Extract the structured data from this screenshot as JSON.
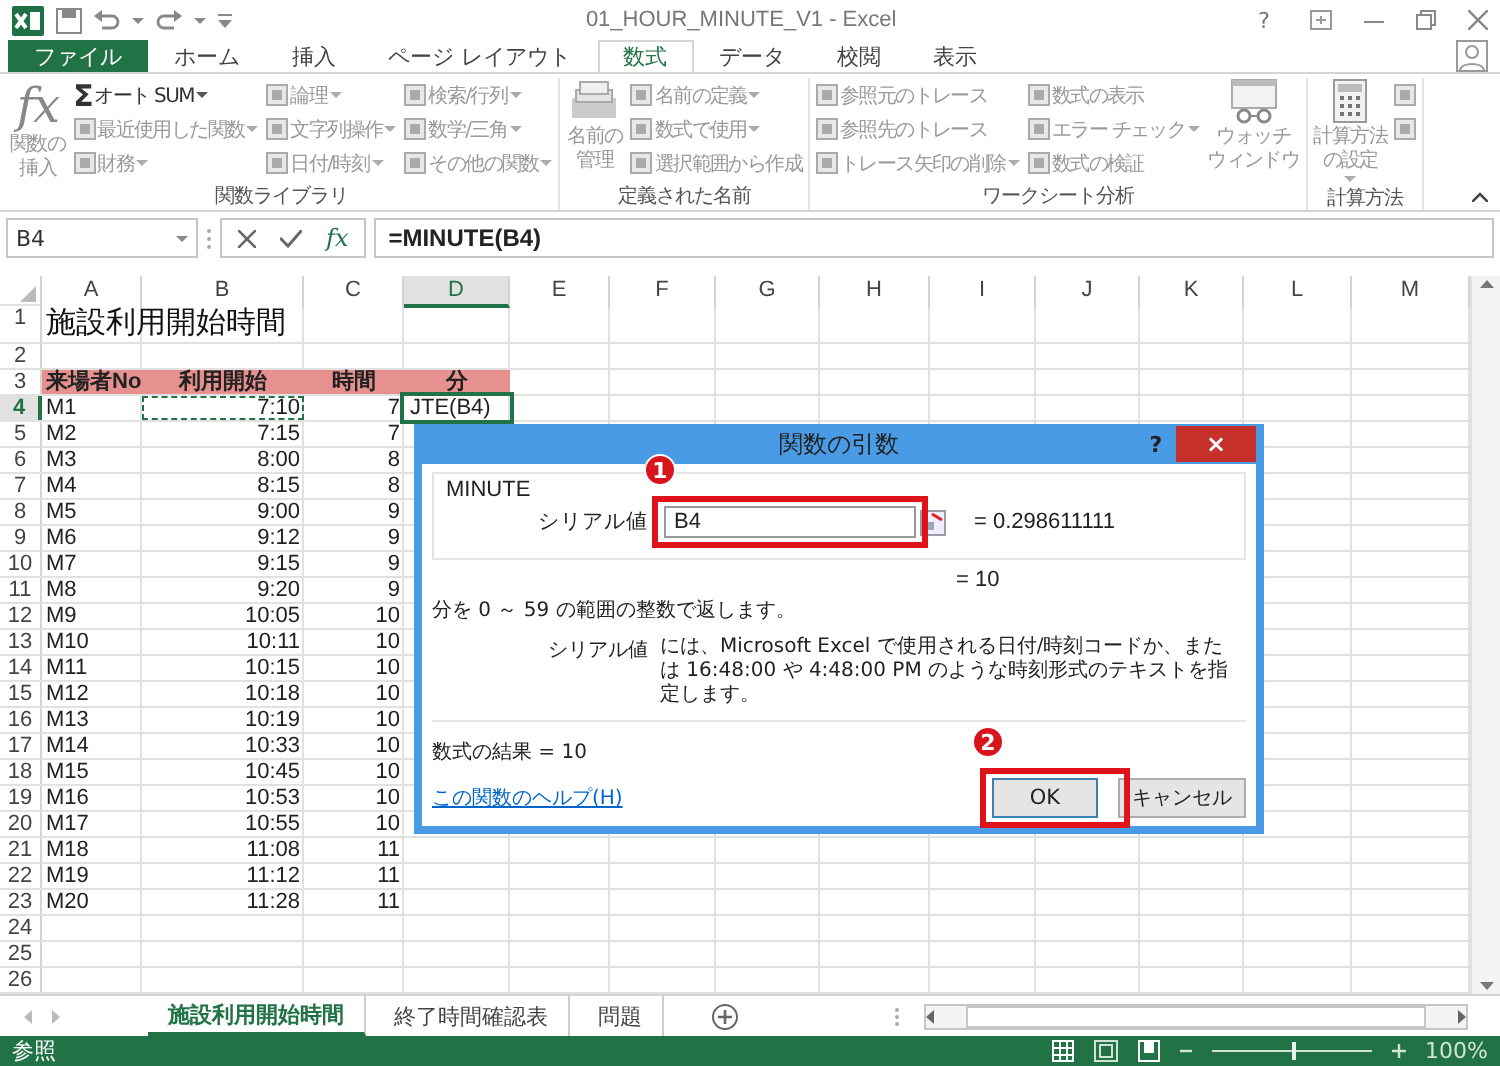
{
  "window": {
    "title": "01_HOUR_MINUTE_V1 - Excel",
    "help": "?"
  },
  "ribbon_tabs": [
    {
      "label": "ファイル",
      "kind": "file",
      "selected": false
    },
    {
      "label": "ホーム",
      "kind": "tab",
      "selected": false
    },
    {
      "label": "挿入",
      "kind": "tab",
      "selected": false
    },
    {
      "label": "ページ レイアウト",
      "kind": "tab",
      "selected": false
    },
    {
      "label": "数式",
      "kind": "tab",
      "selected": true
    },
    {
      "label": "データ",
      "kind": "tab",
      "selected": false
    },
    {
      "label": "校閲",
      "kind": "tab",
      "selected": false
    },
    {
      "label": "表示",
      "kind": "tab",
      "selected": false
    }
  ],
  "ribbon": {
    "groups": [
      {
        "label": "関数ライブラリ",
        "columns": [
          [
            {
              "kind": "large",
              "icon_text": "fx",
              "label_lines": [
                "関数の",
                "挿入"
              ],
              "disabled": true,
              "dropdown": false
            }
          ],
          [
            {
              "kind": "small",
              "icon_text": "Σ",
              "label": "オート SUM",
              "disabled": false,
              "dropdown": true
            },
            {
              "kind": "small",
              "label": "最近使用した関数",
              "disabled": true,
              "dropdown": true
            },
            {
              "kind": "small",
              "label": "財務",
              "disabled": true,
              "dropdown": true
            }
          ],
          [
            {
              "kind": "small",
              "label": "論理",
              "disabled": true,
              "dropdown": true
            },
            {
              "kind": "small",
              "label": "文字列操作",
              "disabled": true,
              "dropdown": true
            },
            {
              "kind": "small",
              "label": "日付/時刻",
              "disabled": true,
              "dropdown": true
            }
          ],
          [
            {
              "kind": "small",
              "label": "検索/行列",
              "disabled": true,
              "dropdown": true
            },
            {
              "kind": "small",
              "label": "数学/三角",
              "disabled": true,
              "dropdown": true
            },
            {
              "kind": "small",
              "label": "その他の関数",
              "disabled": true,
              "dropdown": true
            }
          ]
        ]
      },
      {
        "label": "定義された名前",
        "columns": [
          [
            {
              "kind": "large",
              "label_lines": [
                "名前の",
                "管理"
              ],
              "disabled": true,
              "dropdown": false
            }
          ],
          [
            {
              "kind": "small",
              "label": "名前の定義",
              "disabled": true,
              "dropdown": true
            },
            {
              "kind": "small",
              "label": "数式で使用",
              "disabled": true,
              "dropdown": true
            },
            {
              "kind": "small",
              "label": "選択範囲から作成",
              "disabled": true,
              "dropdown": false
            }
          ]
        ]
      },
      {
        "label": "ワークシート分析",
        "columns": [
          [
            {
              "kind": "small",
              "label": "参照元のトレース",
              "disabled": true,
              "dropdown": false
            },
            {
              "kind": "small",
              "label": "参照先のトレース",
              "disabled": true,
              "dropdown": false
            },
            {
              "kind": "small",
              "label": "トレース矢印の削除",
              "disabled": true,
              "dropdown": true
            }
          ],
          [
            {
              "kind": "small",
              "label": "数式の表示",
              "disabled": true,
              "dropdown": false
            },
            {
              "kind": "small",
              "label": "エラー チェック",
              "disabled": true,
              "dropdown": true
            },
            {
              "kind": "small",
              "label": "数式の検証",
              "disabled": true,
              "dropdown": false
            }
          ],
          [
            {
              "kind": "large",
              "label_lines": [
                "ウォッチ",
                "ウィンドウ"
              ],
              "disabled": true,
              "dropdown": false
            }
          ]
        ]
      },
      {
        "label": "計算方法",
        "columns": [
          [
            {
              "kind": "large",
              "label_lines": [
                "計算方法",
                "の設定"
              ],
              "disabled": true,
              "dropdown": true
            }
          ],
          [
            {
              "kind": "icon",
              "disabled": true,
              "dropdown": false
            },
            {
              "kind": "icon",
              "disabled": true,
              "dropdown": false
            }
          ]
        ]
      }
    ]
  },
  "formula_bar": {
    "name_box": "B4",
    "fx": "fx",
    "formula": "=MINUTE(B4)"
  },
  "grid": {
    "columns": [
      {
        "label": "A",
        "selected": false
      },
      {
        "label": "B",
        "selected": false
      },
      {
        "label": "C",
        "selected": false
      },
      {
        "label": "D",
        "selected": true
      },
      {
        "label": "E",
        "selected": false
      },
      {
        "label": "F",
        "selected": false
      },
      {
        "label": "G",
        "selected": false
      },
      {
        "label": "H",
        "selected": false
      },
      {
        "label": "I",
        "selected": false
      },
      {
        "label": "J",
        "selected": false
      },
      {
        "label": "K",
        "selected": false
      },
      {
        "label": "L",
        "selected": false
      },
      {
        "label": "M",
        "selected": false
      }
    ],
    "rows": [
      {
        "label": "1",
        "kind": "title",
        "selected": false,
        "cells": [
          "施設利用開始時間"
        ]
      },
      {
        "label": "2",
        "kind": "data",
        "selected": false,
        "cells": []
      },
      {
        "label": "3",
        "kind": "header",
        "selected": false,
        "cells": [
          "来場者No",
          "利用開始",
          "時間",
          "分"
        ]
      },
      {
        "label": "4",
        "kind": "editing",
        "selected": true,
        "cells": [
          "M1",
          "7:10",
          "7",
          "JTE(B4)"
        ]
      },
      {
        "label": "5",
        "kind": "data",
        "selected": false,
        "cells": [
          "M2",
          "7:15",
          "7"
        ]
      },
      {
        "label": "6",
        "kind": "data",
        "selected": false,
        "cells": [
          "M3",
          "8:00",
          "8"
        ]
      },
      {
        "label": "7",
        "kind": "data",
        "selected": false,
        "cells": [
          "M4",
          "8:15",
          "8"
        ]
      },
      {
        "label": "8",
        "kind": "data",
        "selected": false,
        "cells": [
          "M5",
          "9:00",
          "9"
        ]
      },
      {
        "label": "9",
        "kind": "data",
        "selected": false,
        "cells": [
          "M6",
          "9:12",
          "9"
        ]
      },
      {
        "label": "10",
        "kind": "data",
        "selected": false,
        "cells": [
          "M7",
          "9:15",
          "9"
        ]
      },
      {
        "label": "11",
        "kind": "data",
        "selected": false,
        "cells": [
          "M8",
          "9:20",
          "9"
        ]
      },
      {
        "label": "12",
        "kind": "data",
        "selected": false,
        "cells": [
          "M9",
          "10:05",
          "10"
        ]
      },
      {
        "label": "13",
        "kind": "data",
        "selected": false,
        "cells": [
          "M10",
          "10:11",
          "10"
        ]
      },
      {
        "label": "14",
        "kind": "data",
        "selected": false,
        "cells": [
          "M11",
          "10:15",
          "10"
        ]
      },
      {
        "label": "15",
        "kind": "data",
        "selected": false,
        "cells": [
          "M12",
          "10:18",
          "10"
        ]
      },
      {
        "label": "16",
        "kind": "data",
        "selected": false,
        "cells": [
          "M13",
          "10:19",
          "10"
        ]
      },
      {
        "label": "17",
        "kind": "data",
        "selected": false,
        "cells": [
          "M14",
          "10:33",
          "10"
        ]
      },
      {
        "label": "18",
        "kind": "data",
        "selected": false,
        "cells": [
          "M15",
          "10:45",
          "10"
        ]
      },
      {
        "label": "19",
        "kind": "data",
        "selected": false,
        "cells": [
          "M16",
          "10:53",
          "10"
        ]
      },
      {
        "label": "20",
        "kind": "data",
        "selected": false,
        "cells": [
          "M17",
          "10:55",
          "10"
        ]
      },
      {
        "label": "21",
        "kind": "data",
        "selected": false,
        "cells": [
          "M18",
          "11:08",
          "11"
        ]
      },
      {
        "label": "22",
        "kind": "data",
        "selected": false,
        "cells": [
          "M19",
          "11:12",
          "11"
        ]
      },
      {
        "label": "23",
        "kind": "data",
        "selected": false,
        "cells": [
          "M20",
          "11:28",
          "11"
        ]
      },
      {
        "label": "24",
        "kind": "data",
        "selected": false,
        "cells": []
      },
      {
        "label": "25",
        "kind": "data",
        "selected": false,
        "cells": []
      },
      {
        "label": "26",
        "kind": "data",
        "selected": false,
        "cells": []
      }
    ]
  },
  "sheet_tabs": [
    {
      "label": "施設利用開始時間",
      "selected": true
    },
    {
      "label": "終了時間確認表",
      "selected": false
    },
    {
      "label": "問題",
      "selected": false
    }
  ],
  "status_bar": {
    "mode": "参照",
    "zoom": "100%",
    "zoom_slider": {
      "level": 0.5
    }
  },
  "dialog": {
    "title": "関数の引数",
    "help": "?",
    "close": "×",
    "function_name": "MINUTE",
    "arguments": [
      {
        "label": "シリアル値",
        "value": "B4",
        "result": "= 0.298611111"
      }
    ],
    "result": "= 10",
    "description": "分を 0 ～ 59 の範囲の整数で返します。",
    "argument_help": {
      "label": "シリアル値",
      "text": "には、Microsoft Excel で使用される日付/時刻コードか、または 16:48:00 や 4:48:00 PM のような時刻形式のテキストを指定します。"
    },
    "formula_result": "数式の結果 =  10",
    "help_link": "この関数のヘルプ(H)",
    "buttons": [
      {
        "label": "OK",
        "kind": "default"
      },
      {
        "label": "キャンセル",
        "kind": "normal"
      }
    ],
    "annotations": [
      {
        "label": "1",
        "kind": "field"
      },
      {
        "label": "2",
        "kind": "button"
      }
    ]
  }
}
